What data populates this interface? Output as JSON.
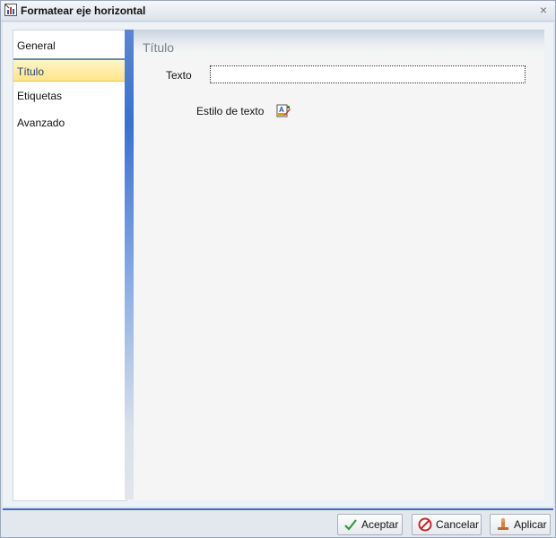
{
  "window": {
    "title": "Formatear eje horizontal"
  },
  "nav": {
    "items": [
      {
        "label": "General",
        "selected": false
      },
      {
        "label": "Título",
        "selected": true
      },
      {
        "label": "Etiquetas",
        "selected": false
      },
      {
        "label": "Avanzado",
        "selected": false
      }
    ]
  },
  "panel": {
    "title": "Título",
    "texto_label": "Texto",
    "texto_value": "",
    "estilo_label": "Estilo de texto"
  },
  "buttons": {
    "accept": "Aceptar",
    "cancel": "Cancelar",
    "apply": "Aplicar"
  },
  "colors": {
    "accent": "#3f6fb6",
    "selected_nav": "#ffe48a"
  },
  "icons": [
    "chart-icon",
    "close-icon",
    "text-style-icon",
    "check-icon",
    "cancel-icon",
    "apply-icon"
  ]
}
